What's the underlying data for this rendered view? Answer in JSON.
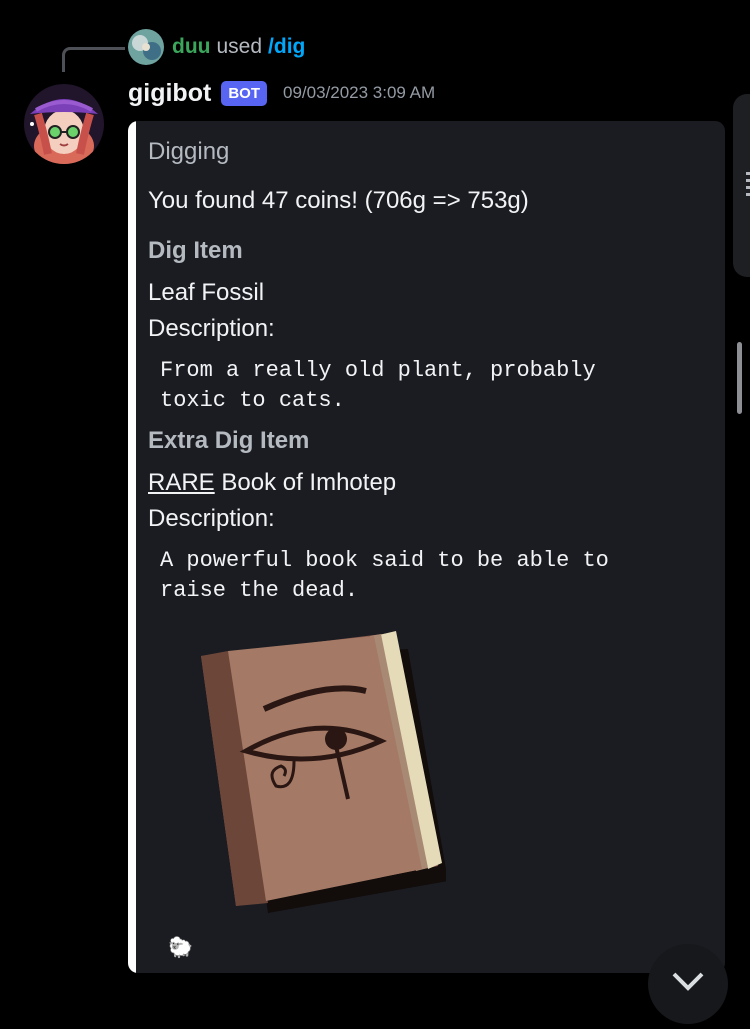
{
  "reply": {
    "user": "duu",
    "used": "used",
    "command": "/dig"
  },
  "message": {
    "username": "gigibot",
    "bot_tag": "BOT",
    "timestamp": "09/03/2023 3:09 AM"
  },
  "embed": {
    "author": "Digging",
    "description": "You found 47 coins! (706g => 753g)",
    "fields": [
      {
        "name": "Dig Item",
        "item": "Leaf Fossil",
        "desc_label": "Description:",
        "desc_lines": [
          "From a really old plant, probably",
          "toxic to cats."
        ]
      },
      {
        "name": "Extra Dig Item",
        "rarity": "RARE",
        "item": "Book of Imhotep",
        "desc_label": "Description:",
        "desc_lines": [
          "A powerful book said to be able to",
          "raise the dead."
        ]
      }
    ],
    "image": "book-of-imhotep-pixel-art",
    "footer_icon": "🐑"
  },
  "colors": {
    "accent": "#ffffff",
    "bot_tag": "#5865f2",
    "reply_user": "#3ba55c",
    "command": "#00a8fc"
  }
}
